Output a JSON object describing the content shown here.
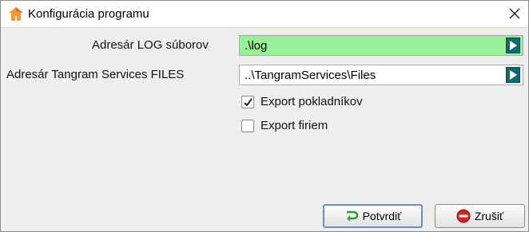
{
  "window": {
    "title": "Konfigurácia programu",
    "app_icon": "house-icon",
    "close_icon": "close-icon"
  },
  "form": {
    "log_dir": {
      "label": "Adresár LOG súborov",
      "value": ".\\log",
      "browse_icon": "play-arrow-icon",
      "highlight_color": "#98f098"
    },
    "files_dir": {
      "label": "Adresár Tangram Services FILES",
      "value": "..\\TangramServices\\Files",
      "browse_icon": "play-arrow-icon"
    },
    "export_cashiers": {
      "label": "Export pokladníkov",
      "checked": true
    },
    "export_companies": {
      "label": "Export firiem",
      "checked": false
    }
  },
  "buttons": {
    "confirm": {
      "label": "Potvrdiť",
      "icon": "confirm-arrow-icon"
    },
    "cancel": {
      "label": "Zrušiť",
      "icon": "stop-sign-icon"
    }
  }
}
